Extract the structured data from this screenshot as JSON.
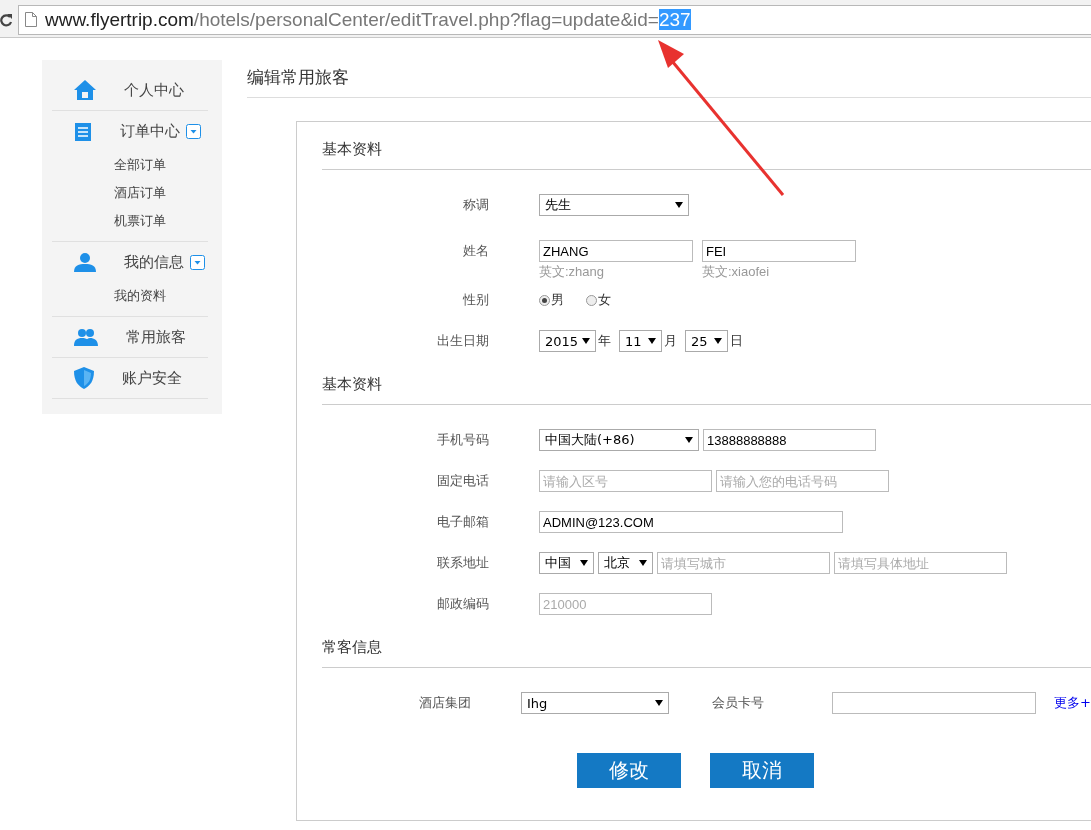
{
  "address_bar": {
    "url_host": "www.flyertrip.com",
    "url_path": "/hotels/personalCenter/editTravel.php?flag=update&id=",
    "url_selected": "237"
  },
  "sidebar": {
    "items": [
      {
        "label": "个人中心"
      },
      {
        "label": "订单中心",
        "children": [
          {
            "label": "全部订单"
          },
          {
            "label": "酒店订单"
          },
          {
            "label": "机票订单"
          }
        ]
      },
      {
        "label": "我的信息",
        "children": [
          {
            "label": "我的资料"
          }
        ]
      },
      {
        "label": "常用旅客"
      },
      {
        "label": "账户安全"
      }
    ]
  },
  "page_title": "编辑常用旅客",
  "sections": [
    {
      "title": "基本资料",
      "fields": [
        {
          "kind": "select",
          "label": "称调",
          "value": "先生"
        },
        {
          "kind": "name",
          "label": "姓名",
          "inputs": [
            {
              "value": "ZHANG",
              "hint": "英文:zhang"
            },
            {
              "value": "FEI",
              "hint": "英文:xiaofei"
            }
          ]
        },
        {
          "kind": "radio",
          "label": "性别",
          "options": [
            {
              "label": "男",
              "selected": true
            },
            {
              "label": "女",
              "selected": false
            }
          ]
        },
        {
          "kind": "date",
          "label": "出生日期",
          "parts": [
            {
              "value": "2015",
              "unit": "年"
            },
            {
              "value": "11",
              "unit": "月"
            },
            {
              "value": "25",
              "unit": "日"
            }
          ]
        }
      ]
    },
    {
      "title": "基本资料",
      "fields": [
        {
          "kind": "phone",
          "label": "手机号码",
          "select": "中国大陆(+86)",
          "value": "13888888888"
        },
        {
          "kind": "inputs",
          "label": "固定电话",
          "placeholders": [
            "请输入区号",
            "请输入您的电话号码"
          ]
        },
        {
          "kind": "text",
          "label": "电子邮箱",
          "value": "ADMIN@123.COM"
        },
        {
          "kind": "address",
          "label": "联系地址",
          "selects": [
            "中国",
            "北京"
          ],
          "placeholders": [
            "请填写城市",
            "请填写具体地址"
          ]
        },
        {
          "kind": "inputs",
          "label": "邮政编码",
          "placeholders": [
            "210000"
          ]
        }
      ]
    },
    {
      "title": "常客信息",
      "fields": [
        {
          "kind": "membership",
          "label": "酒店集团",
          "select": "Ihg",
          "card_label": "会员卡号",
          "link": "更多+"
        }
      ]
    }
  ],
  "buttons": [
    "修改",
    "取消"
  ]
}
